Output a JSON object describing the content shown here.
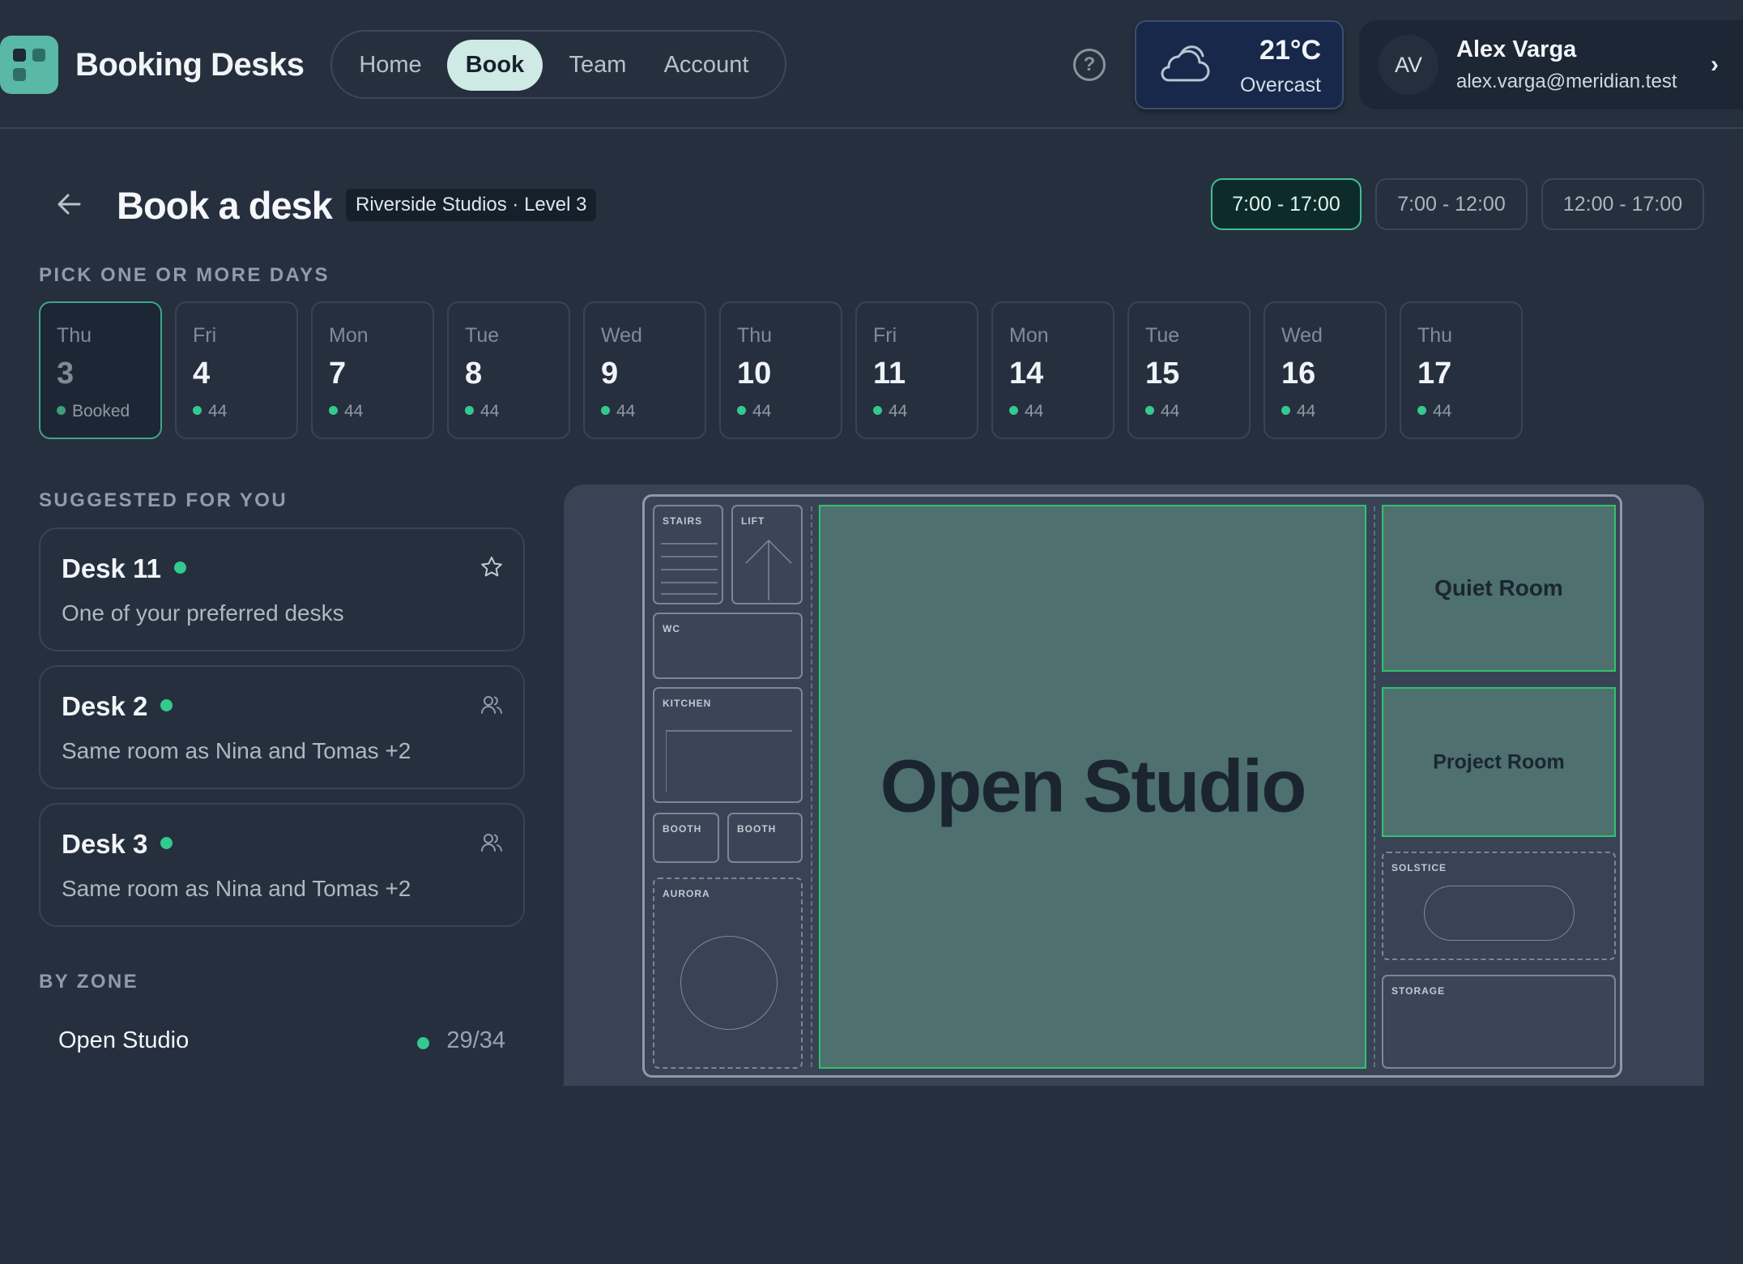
{
  "app": {
    "title": "Booking Desks",
    "accent_color": "#5ab8a6"
  },
  "nav": {
    "items": [
      {
        "label": "Home",
        "active": false
      },
      {
        "label": "Book",
        "active": true
      },
      {
        "label": "Team",
        "active": false
      },
      {
        "label": "Account",
        "active": false
      }
    ]
  },
  "header": {
    "help_icon": "question-circle-icon",
    "weather": {
      "temperature": "21°C",
      "condition": "Overcast",
      "icon": "cloud-icon"
    },
    "user": {
      "initials": "AV",
      "name": "Alex Varga",
      "email": "alex.varga@meridian.test"
    }
  },
  "page": {
    "title": "Book a desk",
    "location": "Riverside Studios · Level 3",
    "time_slots": [
      {
        "label": "7:00 - 17:00",
        "active": true
      },
      {
        "label": "7:00 - 12:00",
        "active": false
      },
      {
        "label": "12:00 - 17:00",
        "active": false
      }
    ]
  },
  "days": {
    "label": "PICK ONE OR MORE DAYS",
    "items": [
      {
        "dow": "Thu",
        "num": "3",
        "status": "Booked",
        "booked": true
      },
      {
        "dow": "Fri",
        "num": "4",
        "status": "44",
        "booked": false
      },
      {
        "dow": "Mon",
        "num": "7",
        "status": "44",
        "booked": false
      },
      {
        "dow": "Tue",
        "num": "8",
        "status": "44",
        "booked": false
      },
      {
        "dow": "Wed",
        "num": "9",
        "status": "44",
        "booked": false
      },
      {
        "dow": "Thu",
        "num": "10",
        "status": "44",
        "booked": false
      },
      {
        "dow": "Fri",
        "num": "11",
        "status": "44",
        "booked": false
      },
      {
        "dow": "Mon",
        "num": "14",
        "status": "44",
        "booked": false
      },
      {
        "dow": "Tue",
        "num": "15",
        "status": "44",
        "booked": false
      },
      {
        "dow": "Wed",
        "num": "16",
        "status": "44",
        "booked": false
      },
      {
        "dow": "Thu",
        "num": "17",
        "status": "44",
        "booked": false
      }
    ]
  },
  "suggestions": {
    "label": "SUGGESTED FOR YOU",
    "items": [
      {
        "title": "Desk 11",
        "desc": "One of your preferred desks",
        "icon": "star-icon"
      },
      {
        "title": "Desk 2",
        "desc": "Same room as Nina and Tomas +2",
        "icon": "people-icon"
      },
      {
        "title": "Desk 3",
        "desc": "Same room as Nina and Tomas +2",
        "icon": "people-icon"
      }
    ]
  },
  "zones": {
    "label": "BY ZONE",
    "items": [
      {
        "name": "Open Studio",
        "count": "29/34"
      }
    ]
  },
  "floorplan": {
    "facilities": {
      "stairs": "STAIRS",
      "lift": "LIFT",
      "wc": "WC",
      "kitchen": "KITCHEN",
      "booth_a": "BOOTH",
      "booth_b": "BOOTH",
      "aurora": "AURORA",
      "solstice": "SOLSTICE",
      "storage": "STORAGE"
    },
    "bookable": {
      "open_studio": "Open Studio",
      "quiet_room": "Quiet Room",
      "project_room": "Project Room"
    },
    "colors": {
      "available_fill": "#4e706f",
      "available_border": "#2fc36b",
      "status_dot": "#34c98f"
    }
  }
}
